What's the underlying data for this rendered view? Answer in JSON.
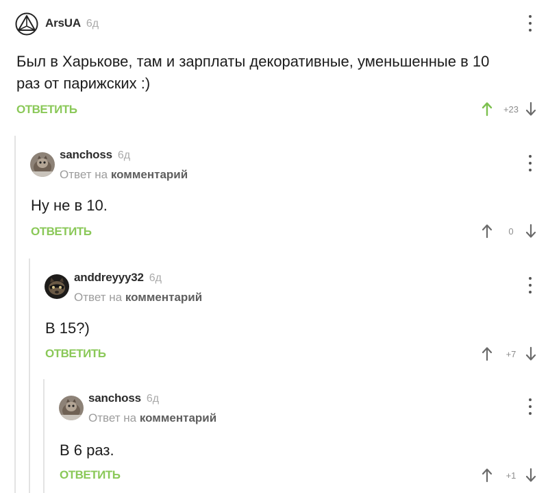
{
  "reply_label": "ОТВЕТИТЬ",
  "reply_to": {
    "prefix": "Ответ на",
    "target": "комментарий"
  },
  "colors": {
    "reply_green": "#8ac858",
    "upvote_green": "#7cc04e",
    "thread_line": "#e3e3e3"
  },
  "comments": [
    {
      "author": "ArsUA",
      "date": "6д",
      "avatar": "triangle-logo-avatar",
      "text_lines": [
        "Был в Харькове, там и зарплаты декоративные, уменьшенные в 10",
        "раз от парижских :)"
      ],
      "votes": "+23",
      "upvoted": true
    },
    {
      "author": "sanchoss",
      "date": "6д",
      "avatar": "cat-photo-avatar",
      "text_lines": [
        "Ну не в 10."
      ],
      "votes": "0",
      "upvoted": false
    },
    {
      "author": "anddreyyy32",
      "date": "6д",
      "avatar": "raccoon-avatar",
      "text_lines": [
        "В 15?)"
      ],
      "votes": "+7",
      "upvoted": false
    },
    {
      "author": "sanchoss",
      "date": "6д",
      "avatar": "cat-photo-avatar",
      "text_lines": [
        "В 6 раз."
      ],
      "votes": "+1",
      "upvoted": false
    }
  ]
}
